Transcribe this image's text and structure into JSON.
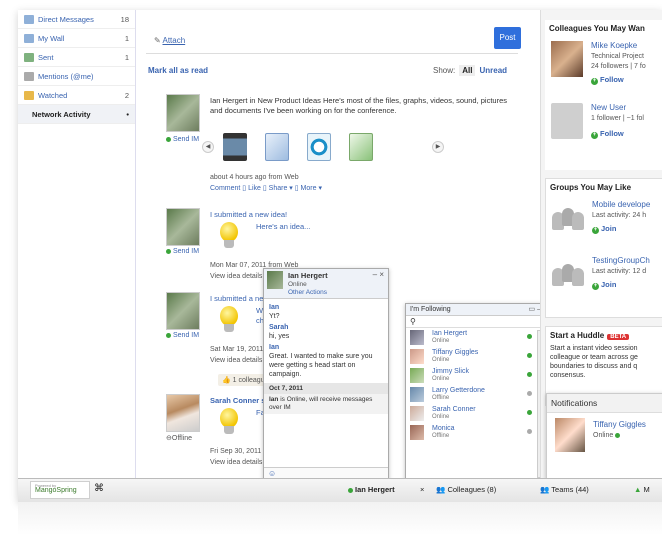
{
  "sidebar": {
    "items": [
      {
        "label": "Direct Messages",
        "count": "18"
      },
      {
        "label": "My Wall",
        "count": "1"
      },
      {
        "label": "Sent",
        "count": "1"
      },
      {
        "label": "Mentions (@me)",
        "count": ""
      },
      {
        "label": "Watched",
        "count": "2"
      },
      {
        "label": "Network Activity",
        "count": "•"
      }
    ]
  },
  "composer": {
    "attach_label": "Attach",
    "post_label": "Post"
  },
  "feed": {
    "mark_all_read": "Mark all as read",
    "show_label": "Show:",
    "show_all": "All",
    "show_unread": "Unread",
    "send_im": "Send IM",
    "offline": "Offline",
    "items": [
      {
        "text": "Ian Hergert in New Product Ideas Here's most of the files, graphs, videos, sound, pictures and documents I've been working on for the conference.",
        "time": "about 4 hours ago  from Web",
        "actions": "Comment ▯ Like ▯ Share ▾ ▯ More ▾"
      },
      {
        "text": "I submitted a new idea!",
        "idea": "Here's an idea...",
        "time": "Mon Mar 07, 2011 from Web",
        "details": "View idea details ▯"
      },
      {
        "text": "I submitted a new idea!",
        "idea": "We sh",
        "idea2": "chariti",
        "time": "Sat Mar 19, 2011",
        "details": "View idea details ▯",
        "likes": "1 colleague"
      },
      {
        "text": "Sarah Conner s",
        "idea": "Facial",
        "time": "Fri Sep 30, 2011",
        "details": "View idea details ▯"
      }
    ]
  },
  "chat": {
    "name": "Ian Hergert",
    "status": "Online",
    "other_actions": "Other Actions",
    "controls": "– ×",
    "messages": [
      {
        "who": "Ian",
        "text": "Yt?"
      },
      {
        "who": "Sarah",
        "text": "hi, yes"
      },
      {
        "who": "Ian",
        "text": "Great. I wanted to make sure you were getting s head start on campaign."
      }
    ],
    "date": "Oct 7, 2011",
    "system_name": "Ian",
    "system_text": "is Online, will receive messages over IM"
  },
  "following": {
    "title": "I'm Following",
    "controls": "▭ –",
    "people": [
      {
        "name": "Ian Hergert",
        "status": "Online",
        "online": true
      },
      {
        "name": "Tiffany Giggles",
        "status": "Online",
        "online": true
      },
      {
        "name": "Jimmy Slick",
        "status": "Online",
        "online": true
      },
      {
        "name": "Larry Getterdone",
        "status": "Offline",
        "online": false
      },
      {
        "name": "Sarah Conner",
        "status": "Online",
        "online": true
      },
      {
        "name": "Monica",
        "status": "Offline",
        "online": false
      }
    ]
  },
  "right": {
    "colleagues_title": "Colleagues You May Wan",
    "colleagues": [
      {
        "name": "Mike Koepke",
        "sub1": "Technical Project",
        "sub2": "24 followers | 7 fo",
        "btn": "Follow"
      },
      {
        "name": "New User",
        "sub1": "1 follower | ~1 fol",
        "sub2": "",
        "btn": "Follow"
      }
    ],
    "groups_title": "Groups You May Like",
    "groups": [
      {
        "name": "Mobile develope",
        "sub": "Last activity: 24 h",
        "btn": "Join"
      },
      {
        "name": "TestingGroupCh",
        "sub": "Last activity: 12 d",
        "btn": "Join"
      }
    ],
    "huddle_title": "Start a Huddle",
    "beta": "BETA",
    "huddle_text": "Start a instant video session colleague or team across ge boundaries to discuss and q consensus.",
    "notifications_title": "Notifications",
    "notif_name": "Tiffany Giggles",
    "notif_status": "Online"
  },
  "bottom": {
    "powered_by": "Powered by",
    "logo": "MangoSpring",
    "chat_tab": "Ian Hergert",
    "chat_close": "×",
    "colleagues": "Colleagues (8)",
    "teams": "Teams (44)",
    "more": "M"
  }
}
